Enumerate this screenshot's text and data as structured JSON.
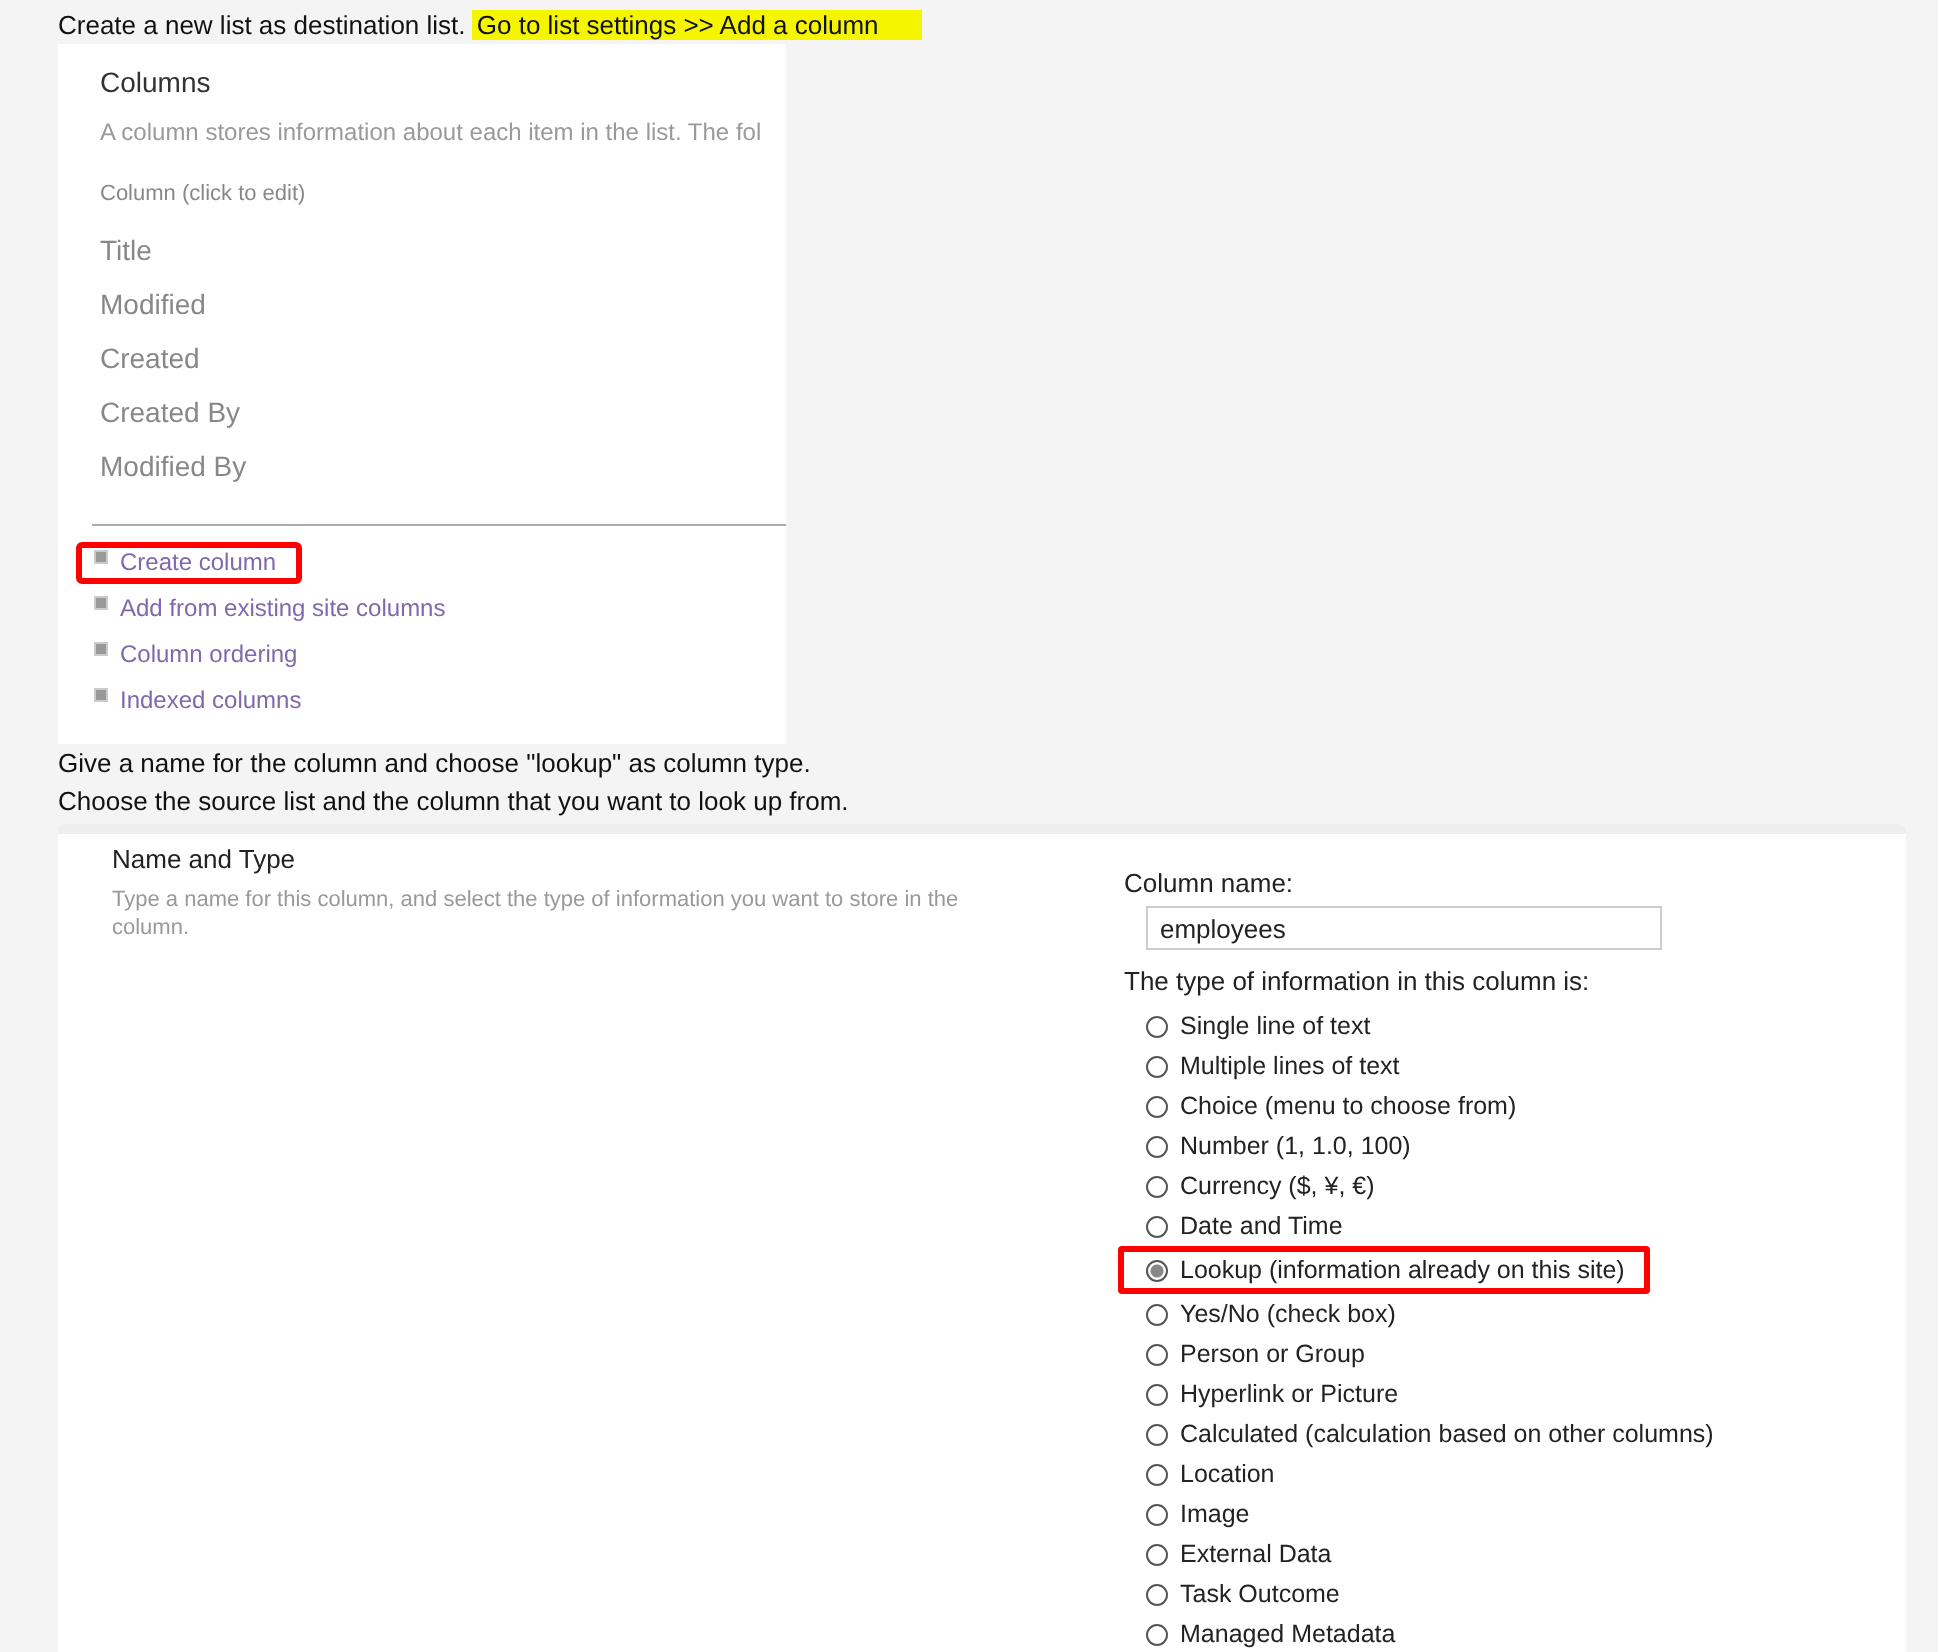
{
  "step_1": {
    "text": "Create a new list as destination list.",
    "highlight": "Go to list settings >> Add a column"
  },
  "columns_settings": {
    "heading": "Columns",
    "description": "A column stores information about each item in the list. The fol",
    "column_header": "Column (click to edit)",
    "columns": [
      "Title",
      "Modified",
      "Created",
      "Created By",
      "Modified By"
    ],
    "links": [
      {
        "label": "Create column",
        "highlighted": true
      },
      {
        "label": "Add from existing site columns",
        "highlighted": false
      },
      {
        "label": "Column ordering",
        "highlighted": false
      },
      {
        "label": "Indexed columns",
        "highlighted": false
      }
    ]
  },
  "step_2": [
    "Give a name for the column and choose \"lookup\" as column type.",
    "Choose the source list and the column that you want to look up from."
  ],
  "name_and_type": {
    "heading": "Name and Type",
    "description": "Type a name for this column, and select the type of information you want to store in the column.",
    "column_name_label": "Column name:",
    "column_name_value": "employees",
    "type_label": "The type of information in this column is:",
    "types": [
      {
        "label": "Single line of text",
        "selected": false,
        "highlighted": false
      },
      {
        "label": "Multiple lines of text",
        "selected": false,
        "highlighted": false
      },
      {
        "label": "Choice (menu to choose from)",
        "selected": false,
        "highlighted": false
      },
      {
        "label": "Number (1, 1.0, 100)",
        "selected": false,
        "highlighted": false
      },
      {
        "label": "Currency ($, ¥, €)",
        "selected": false,
        "highlighted": false
      },
      {
        "label": "Date and Time",
        "selected": false,
        "highlighted": false
      },
      {
        "label": "Lookup (information already on this site)",
        "selected": true,
        "highlighted": true
      },
      {
        "label": "Yes/No (check box)",
        "selected": false,
        "highlighted": false
      },
      {
        "label": "Person or Group",
        "selected": false,
        "highlighted": false
      },
      {
        "label": "Hyperlink or Picture",
        "selected": false,
        "highlighted": false
      },
      {
        "label": "Calculated (calculation based on other columns)",
        "selected": false,
        "highlighted": false
      },
      {
        "label": "Location",
        "selected": false,
        "highlighted": false
      },
      {
        "label": "Image",
        "selected": false,
        "highlighted": false
      },
      {
        "label": "External Data",
        "selected": false,
        "highlighted": false
      },
      {
        "label": "Task Outcome",
        "selected": false,
        "highlighted": false
      },
      {
        "label": "Managed Metadata",
        "selected": false,
        "highlighted": false
      }
    ]
  }
}
